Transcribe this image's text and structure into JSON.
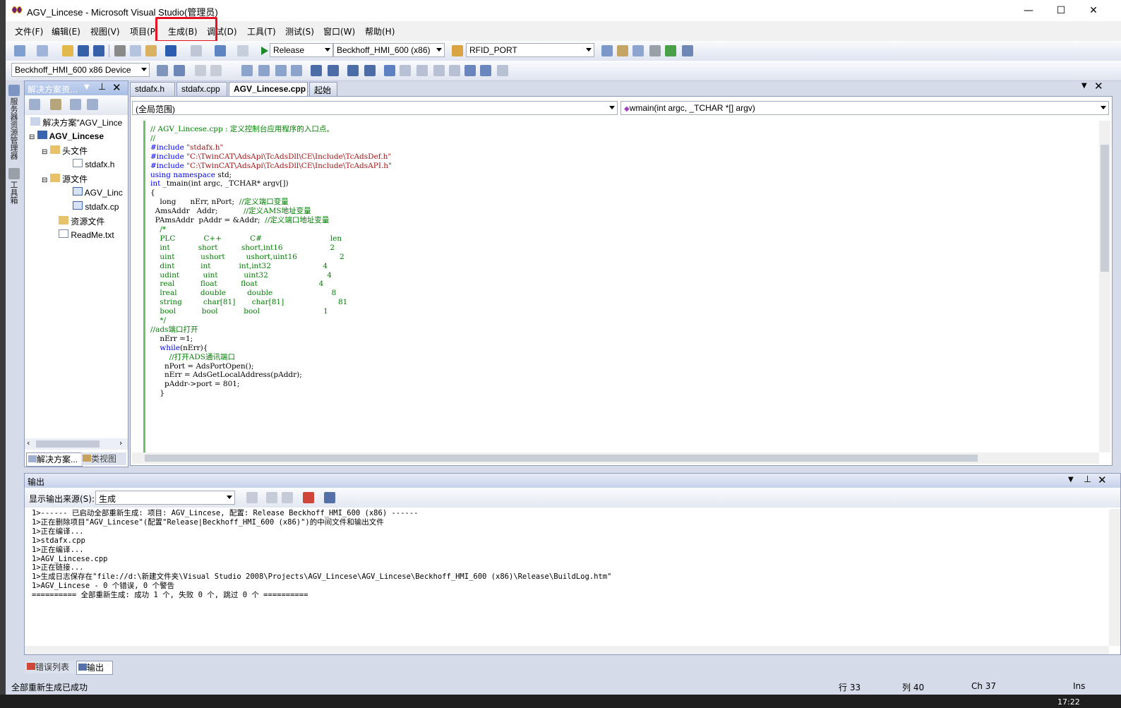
{
  "window": {
    "title": "AGV_Lincese - Microsoft Visual Studio(管理员)",
    "minimize": "—",
    "maximize": "☐",
    "close": "✕"
  },
  "menu": [
    "文件(F)",
    "编辑(E)",
    "视图(V)",
    "项目(P",
    "生成(B)",
    "调试(D)",
    "工具(T)",
    "测试(S)",
    "窗口(W)",
    "帮助(H)"
  ],
  "toolbar1": {
    "config": "Release",
    "platform": "Beckhoff_HMI_600 (x86)",
    "find": "RFID_PORT"
  },
  "toolbar2": {
    "device": "Beckhoff_HMI_600 x86 Device"
  },
  "left_strip": {
    "server_explorer": "服务器资源管理器",
    "toolbox": "工具箱"
  },
  "solution": {
    "header": "解决方案资...",
    "items": [
      {
        "label": "解决方案\"AGV_Lince"
      },
      {
        "label": "AGV_Lincese"
      },
      {
        "label": "头文件"
      },
      {
        "label": "stdafx.h"
      },
      {
        "label": "源文件"
      },
      {
        "label": "AGV_Linc"
      },
      {
        "label": "stdafx.cp"
      },
      {
        "label": "资源文件"
      },
      {
        "label": "ReadMe.txt"
      }
    ],
    "tab_solution": "解决方案...",
    "tab_class": "类视图"
  },
  "editor": {
    "tabs": [
      "stdafx.h",
      "stdafx.cpp",
      "AGV_Lincese.cpp",
      "起始页"
    ],
    "scope": "(全局范围)",
    "function": "wmain(int argc, _TCHAR *[] argv)",
    "lines": [
      "// AGV_Lincese.cpp : 定义控制台应用程序的入口点。",
      "//",
      "",
      "#include \"stdafx.h\"",
      "#include \"C:\\TwinCAT\\AdsApi\\TcAdsDll\\CE\\Include\\TcAdsDef.h\"",
      "#include \"C:\\TwinCAT\\AdsApi\\TcAdsDll\\CE\\Include\\TcAdsAPI.h\"",
      "using namespace std;",
      "",
      "int _tmain(int argc, _TCHAR* argv[])",
      "{",
      "    long      nErr, nPort;  //定义端口变量",
      "  AmsAddr   Addr;           //定义AMS地址变量",
      "  PAmsAddr  pAddr = &Addr;  //定义端口地址变量",
      "",
      "",
      "    /*",
      "    PLC            C++            C#                             len",
      "",
      "    int            short          short,int16                    2",
      "    uint           ushort         ushort,uint16                  2",
      "    dint           int            int,int32                      4",
      "    udint          uint           uint32                         4",
      "    real           float          float                          4",
      "    lreal          double         double                         8",
      "    string         char[81]       char[81]                       81",
      "    bool           bool           bool                           1",
      "    */",
      "//ads端口打开",
      "    nErr =1;",
      "    while(nErr){",
      "        //打开ADS通讯端口",
      "      nPort = AdsPortOpen();",
      "      nErr = AdsGetLocalAddress(pAddr);",
      "      pAddr->port = 801;",
      "    }"
    ]
  },
  "output": {
    "title": "输出",
    "source_label": "显示输出来源(S):",
    "source_value": "生成",
    "lines": [
      "1>------ 已启动全部重新生成: 项目: AGV_Lincese, 配置: Release Beckhoff_HMI_600 (x86) ------",
      "1>正在删除项目\"AGV_Lincese\"(配置\"Release|Beckhoff_HMI_600 (x86)\")的中间文件和输出文件",
      "1>正在编译...",
      "1>stdafx.cpp",
      "1>正在编译...",
      "1>AGV_Lincese.cpp",
      "1>正在链接...",
      "1>生成日志保存在\"file://d:\\新建文件夹\\Visual Studio 2008\\Projects\\AGV_Lincese\\AGV_Lincese\\Beckhoff_HMI_600 (x86)\\Release\\BuildLog.htm\"",
      "1>AGV_Lincese - 0 个错误, 0 个警告",
      "========== 全部重新生成: 成功 1 个, 失败 0 个, 跳过 0 个 =========="
    ],
    "tab_errors": "错误列表",
    "tab_output": "输出"
  },
  "status": {
    "message": "全部重新生成已成功",
    "line": "行 33",
    "col": "列 40",
    "ch": "Ch 37",
    "mode": "Ins"
  },
  "taskbar": {
    "time": "17:22"
  }
}
